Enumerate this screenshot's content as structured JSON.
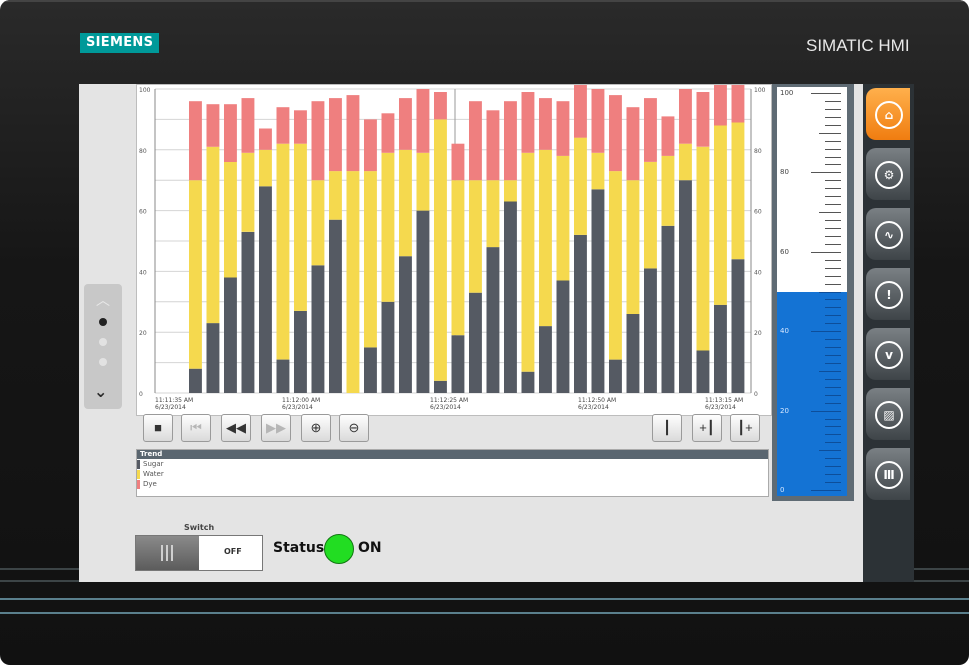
{
  "device": {
    "brand": "SIEMENS",
    "model": "SIMATIC HMI"
  },
  "trend_toolbar": {
    "left_icons": [
      "stop-icon",
      "skip-to-start-icon",
      "rewind-icon",
      "fast-forward-icon",
      "zoom-in-icon",
      "zoom-out-icon"
    ],
    "right_icons": [
      "ruler-icon",
      "ruler-back-icon",
      "ruler-forward-icon"
    ]
  },
  "legend": {
    "header": "Trend",
    "rows": [
      {
        "label": "Sugar",
        "color": "#555a63"
      },
      {
        "label": "Water",
        "color": "#f5d94e"
      },
      {
        "label": "Dye",
        "color": "#ef7f7f"
      }
    ]
  },
  "chart_data": {
    "type": "bar",
    "stacked": true,
    "ylim": [
      0,
      100
    ],
    "left_axis_ticks": [
      "100",
      "80",
      "60",
      "40",
      "20",
      "0"
    ],
    "right_axis_ticks": [
      "100",
      "80",
      "60",
      "40",
      "20",
      "0"
    ],
    "time_labels": [
      {
        "time": "11:11:35 AM",
        "date": "6/23/2014"
      },
      {
        "time": "11:12:00 AM",
        "date": "6/23/2014"
      },
      {
        "time": "11:12:25 AM",
        "date": "6/23/2014"
      },
      {
        "time": "11:12:50 AM",
        "date": "6/23/2014"
      },
      {
        "time": "11:13:15 AM",
        "date": "6/23/2014"
      }
    ],
    "colors": {
      "Sugar": "#555a63",
      "Water": "#f5d94e",
      "Dye": "#ef7f7f"
    },
    "series": [
      {
        "name": "Sugar",
        "values": [
          8,
          23,
          38,
          53,
          68,
          11,
          27,
          42,
          57,
          0,
          15,
          30,
          45,
          60,
          4,
          19,
          33,
          48,
          63,
          7,
          22,
          37,
          52,
          67,
          11,
          26,
          41,
          55,
          70,
          14,
          29,
          44
        ]
      },
      {
        "name": "Water",
        "values": [
          62,
          58,
          38,
          26,
          12,
          71,
          55,
          28,
          16,
          73,
          58,
          49,
          35,
          19,
          86,
          51,
          37,
          22,
          7,
          72,
          58,
          41,
          32,
          12,
          62,
          44,
          35,
          23,
          12,
          67,
          59,
          45
        ]
      },
      {
        "name": "Dye",
        "values": [
          26,
          14,
          19,
          18,
          7,
          12,
          11,
          26,
          24,
          25,
          17,
          13,
          17,
          21,
          9,
          12,
          26,
          23,
          26,
          20,
          17,
          18,
          19,
          21,
          25,
          24,
          21,
          13,
          18,
          18,
          20,
          22
        ]
      }
    ]
  },
  "gauge": {
    "value": 50,
    "labels": [
      "100",
      "80",
      "60",
      "40",
      "20",
      "0"
    ],
    "fill_color": "#1473d4"
  },
  "nav_buttons": [
    {
      "name": "home-icon",
      "glyph": "⌂"
    },
    {
      "name": "gear-icon",
      "glyph": "⚙"
    },
    {
      "name": "trend-icon",
      "glyph": "∿"
    },
    {
      "name": "alarm-icon",
      "glyph": "!"
    },
    {
      "name": "diagnostics-icon",
      "glyph": "ⅴ"
    },
    {
      "name": "image-icon",
      "glyph": "▨"
    },
    {
      "name": "settings-sliders-icon",
      "glyph": "Ⅲ"
    }
  ],
  "switch": {
    "label": "Switch",
    "state_text": "OFF"
  },
  "status": {
    "label": "Status",
    "value": "ON",
    "lamp_color": "#22dd22"
  }
}
